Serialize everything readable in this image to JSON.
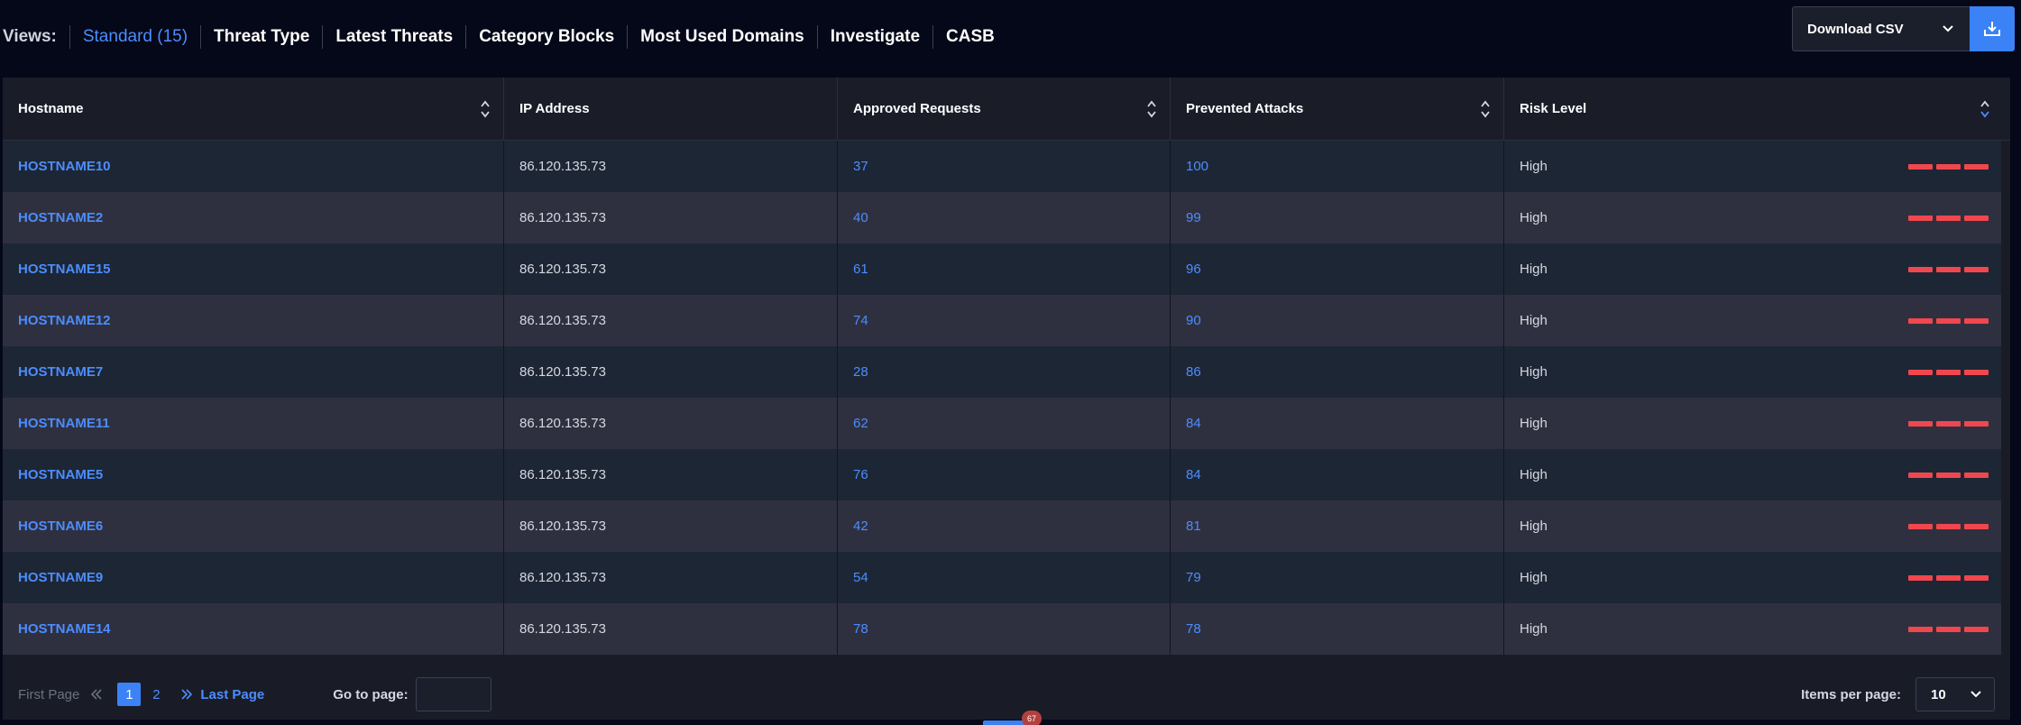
{
  "views": {
    "label": "Views:",
    "tabs": [
      {
        "label": "Standard (15)",
        "active": true
      },
      {
        "label": "Threat Type"
      },
      {
        "label": "Latest Threats"
      },
      {
        "label": "Category Blocks"
      },
      {
        "label": "Most Used Domains"
      },
      {
        "label": "Investigate"
      },
      {
        "label": "CASB"
      }
    ]
  },
  "download": {
    "label": "Download CSV"
  },
  "table": {
    "columns": [
      "Hostname",
      "IP Address",
      "Approved Requests",
      "Prevented Attacks",
      "Risk Level"
    ],
    "rows": [
      {
        "hostname": "HOSTNAME10",
        "ip": "86.120.135.73",
        "approved": "37",
        "prevented": "100",
        "risk": "High"
      },
      {
        "hostname": "HOSTNAME2",
        "ip": "86.120.135.73",
        "approved": "40",
        "prevented": "99",
        "risk": "High"
      },
      {
        "hostname": "HOSTNAME15",
        "ip": "86.120.135.73",
        "approved": "61",
        "prevented": "96",
        "risk": "High"
      },
      {
        "hostname": "HOSTNAME12",
        "ip": "86.120.135.73",
        "approved": "74",
        "prevented": "90",
        "risk": "High"
      },
      {
        "hostname": "HOSTNAME7",
        "ip": "86.120.135.73",
        "approved": "28",
        "prevented": "86",
        "risk": "High"
      },
      {
        "hostname": "HOSTNAME11",
        "ip": "86.120.135.73",
        "approved": "62",
        "prevented": "84",
        "risk": "High"
      },
      {
        "hostname": "HOSTNAME5",
        "ip": "86.120.135.73",
        "approved": "76",
        "prevented": "84",
        "risk": "High"
      },
      {
        "hostname": "HOSTNAME6",
        "ip": "86.120.135.73",
        "approved": "42",
        "prevented": "81",
        "risk": "High"
      },
      {
        "hostname": "HOSTNAME9",
        "ip": "86.120.135.73",
        "approved": "54",
        "prevented": "79",
        "risk": "High"
      },
      {
        "hostname": "HOSTNAME14",
        "ip": "86.120.135.73",
        "approved": "78",
        "prevented": "78",
        "risk": "High"
      }
    ]
  },
  "pagination": {
    "first_label": "First Page",
    "pages": [
      "1",
      "2"
    ],
    "current_page": "1",
    "last_label": "Last Page",
    "goto_label": "Go to page:",
    "goto_value": "",
    "items_per_page_label": "Items per page:",
    "items_per_page_value": "10"
  },
  "notification_badge": "67",
  "colors": {
    "accent": "#3b82f6",
    "link": "#4c8dff",
    "risk_high": "#f0474e",
    "background": "#050818"
  }
}
